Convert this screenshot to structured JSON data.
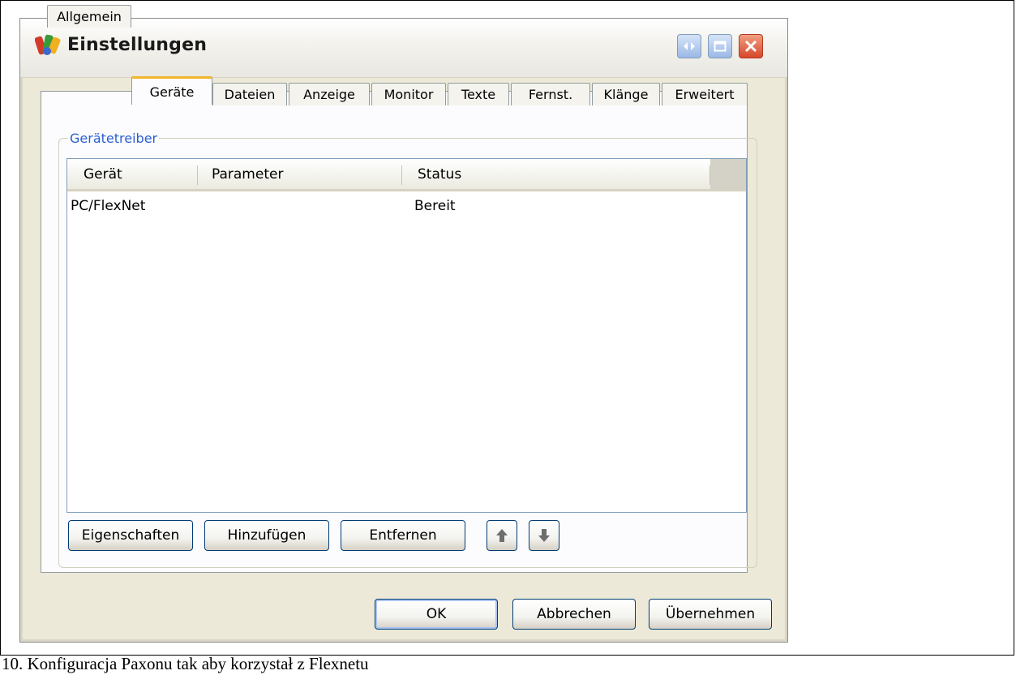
{
  "window": {
    "title": "Einstellungen"
  },
  "tabs": [
    {
      "label": "Allgemein"
    },
    {
      "label": "Geräte",
      "active": true
    },
    {
      "label": "Dateien"
    },
    {
      "label": "Anzeige"
    },
    {
      "label": "Monitor"
    },
    {
      "label": "Texte"
    },
    {
      "label": "Fernst."
    },
    {
      "label": "Klänge"
    },
    {
      "label": "Erweitert"
    }
  ],
  "group": {
    "label": "Gerätetreiber"
  },
  "list": {
    "columns": [
      "Gerät",
      "Parameter",
      "Status"
    ],
    "rows": [
      {
        "geraet": "PC/FlexNet",
        "parameter": "",
        "status": "Bereit"
      }
    ]
  },
  "actions": {
    "properties": "Eigenschaften",
    "add": "Hinzufügen",
    "remove": "Entfernen",
    "move_up_icon": "arrow-up-icon",
    "move_down_icon": "arrow-down-icon"
  },
  "dialog_buttons": {
    "ok": "OK",
    "cancel": "Abbrechen",
    "apply": "Übernehmen"
  },
  "caption": "10. Konfiguracja Paxonu tak aby korzystał z Flexnetu"
}
